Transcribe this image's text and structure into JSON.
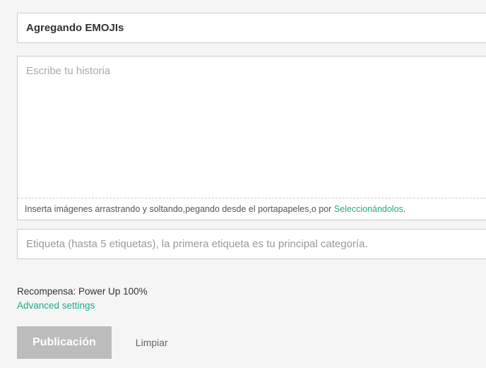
{
  "title": {
    "value": "Agregando EMOJIs"
  },
  "story": {
    "placeholder": "Escribe tu historia",
    "value": ""
  },
  "imageHint": {
    "prefix": "Inserta imágenes arrastrando y soltando,pegando desde el portapapeles,o por ",
    "link": "Seleccionándolos",
    "suffix": "."
  },
  "tags": {
    "placeholder": "Etiqueta (hasta 5 etiquetas), la primera etiqueta es tu principal categoría.",
    "value": ""
  },
  "reward": {
    "label": "Recompensa: Power Up 100%"
  },
  "advanced": {
    "label": "Advanced settings"
  },
  "buttons": {
    "publish": "Publicación",
    "clear": "Limpiar"
  }
}
